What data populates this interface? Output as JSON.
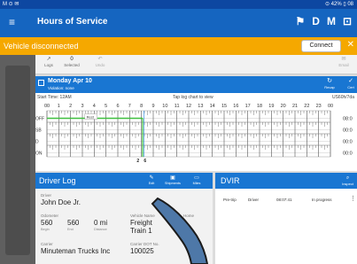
{
  "status_bar": {
    "left": "M ⊙ ✉",
    "right": "⊙ 42% ▯ 08"
  },
  "app_bar": {
    "title": "Hours of Service",
    "actions": [
      "⚑",
      "D",
      "M",
      "⊡"
    ]
  },
  "banner": {
    "message": "Vehicle disconnected",
    "connect_label": "Connect",
    "close": "✕"
  },
  "toolbar": {
    "logs": {
      "count": "0",
      "label": "Logs"
    },
    "selected": {
      "count": "0",
      "label": "Selected"
    },
    "undo": {
      "label": "Undo"
    },
    "email": {
      "label": "Email"
    }
  },
  "day": {
    "date": "Monday Apr 10",
    "violation": "Violation: none",
    "recap_label": "Recap",
    "cert_label": "Cert"
  },
  "graph": {
    "start_time": "Start Time: 12AM",
    "hint": "Tap log chart to view",
    "timezone": "US60h/7da",
    "hours": [
      "00",
      "1",
      "2",
      "3",
      "4",
      "5",
      "6",
      "7",
      "8",
      "9",
      "10",
      "11",
      "12",
      "13",
      "14",
      "15",
      "16",
      "17",
      "18",
      "19",
      "20",
      "21",
      "22",
      "23",
      "00"
    ],
    "rows": [
      "OFF",
      "SB",
      "D",
      "ON"
    ],
    "totals": [
      "08:0",
      "00:0",
      "00:0",
      "00:0"
    ],
    "event_label": "Rest",
    "bottom_marks": [
      "2",
      "6"
    ],
    "colors": {
      "off_line": "#3fbf3f",
      "current_line": "#1e88e5",
      "tick": "#555"
    }
  },
  "driver_log": {
    "title": "Driver Log",
    "actions": [
      {
        "label": "Edit",
        "icon": "pencil-icon"
      },
      {
        "label": "Shipments",
        "icon": "box-icon"
      },
      {
        "label": "Miles",
        "icon": "truck-icon"
      }
    ],
    "driver_label": "Driver",
    "driver_name": "John Doe Jr.",
    "odometer_label": "Odometer",
    "odo_begin": "560",
    "odo_begin_sub": "Begin",
    "odo_end": "560",
    "odo_end_sub": "End",
    "distance": "0 mi",
    "distance_sub": "Distance",
    "vehicle_label": "Vehicle Name",
    "vehicle_value": "Freight Train 1",
    "home_label": "Home",
    "carrier_label": "Carrier",
    "carrier_value": "Minuteman Trucks Inc",
    "dot_label": "Carrier DOT No.",
    "dot_value": "100025"
  },
  "dvir": {
    "title": "DVIR",
    "inspect_label": "Inspect",
    "row": {
      "type": "Pre-trip",
      "role": "Driver",
      "time": "08:07:41",
      "status": "In progress",
      "more": "⋮"
    }
  },
  "colors": {
    "primary": "#1976d2",
    "appbar": "#1565c0",
    "banner": "#f5a800"
  }
}
